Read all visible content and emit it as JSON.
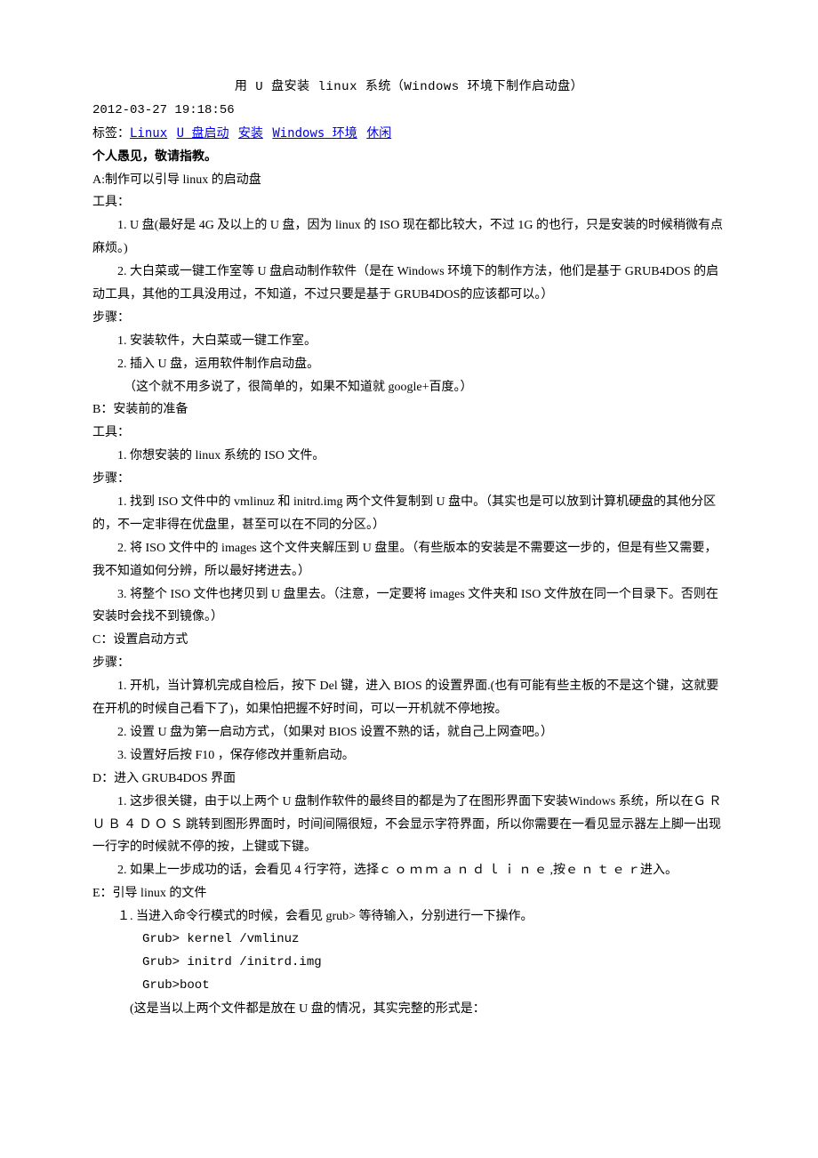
{
  "title": "用 U 盘安装 linux 系统（Windows 环境下制作启动盘）",
  "datetime": "2012-03-27 19:18:56",
  "tagsLabel": "标签：",
  "tags": [
    "Linux",
    "U 盘启动",
    "安装",
    "Windows 环境",
    "休闲"
  ],
  "noticeLine": "个人愚见，敬请指教。",
  "sectionA": {
    "heading": "A:制作可以引导 linux 的启动盘",
    "toolsLabel": "工具：",
    "tool1": "1. U 盘(最好是 4G 及以上的 U 盘，因为 linux 的 ISO 现在都比较大，不过 1G 的也行，只是安装的时候稍微有点麻烦。)",
    "tool2": "2. 大白菜或一键工作室等 U 盘启动制作软件（是在 Windows 环境下的制作方法，他们是基于 GRUB4DOS 的启动工具，其他的工具没用过，不知道，不过只要是基于 GRUB4DOS的应该都可以。）",
    "stepsLabel": "步骤：",
    "step1": "1. 安装软件，大白菜或一键工作室。",
    "step2": "2. 插入 U 盘，运用软件制作启动盘。",
    "step2Note": "（这个就不用多说了，很简单的，如果不知道就 google+百度。）"
  },
  "sectionB": {
    "heading": "B：安装前的准备",
    "toolsLabel": "工具：",
    "tool1": "1. 你想安装的 linux 系统的 ISO 文件。",
    "stepsLabel": "步骤：",
    "step1": "1. 找到 ISO 文件中的 vmlinuz 和 initrd.img 两个文件复制到 U 盘中。（其实也是可以放到计算机硬盘的其他分区的，不一定非得在优盘里，甚至可以在不同的分区。）",
    "step2": "2. 将 ISO 文件中的 images 这个文件夹解压到 U 盘里。（有些版本的安装是不需要这一步的，但是有些又需要，我不知道如何分辨，所以最好拷进去。）",
    "step3": "3. 将整个 ISO 文件也拷贝到 U 盘里去。（注意，一定要将 images 文件夹和 ISO 文件放在同一个目录下。否则在安装时会找不到镜像。）"
  },
  "sectionC": {
    "heading": "C：设置启动方式",
    "stepsLabel": "步骤：",
    "step1": "1. 开机，当计算机完成自检后，按下 Del 键，进入 BIOS 的设置界面.(也有可能有些主板的不是这个键，这就要在开机的时候自己看下了)，如果怕把握不好时间，可以一开机就不停地按。",
    "step2": "2. 设置 U 盘为第一启动方式，（如果对 BIOS 设置不熟的话，就自己上网查吧。）",
    "step3": "3. 设置好后按 F10 ，保存修改并重新启动。"
  },
  "sectionD": {
    "heading": "D：进入 GRUB4DOS 界面",
    "step1": "1. 这步很关键，由于以上两个 U 盘制作软件的最终目的都是为了在图形界面下安装Windows 系统，所以在Ｇ Ｒ Ｕ Ｂ ４ Ｄ Ｏ Ｓ 跳转到图形界面时，时间间隔很短，不会显示字符界面，所以你需要在一看见显示器左上脚一出现一行字的时候就不停的按，上键或下键。",
    "step2": "2. 如果上一步成功的话，会看见 4 行字符，选择ｃ ｏ ｍ ｍ ａ ｎ ｄ  ｌ ｉ ｎ ｅ ,按ｅ ｎ ｔ ｅ ｒ进入。"
  },
  "sectionE": {
    "heading": "E：引导 linux 的文件",
    "step1": "１. 当进入命令行模式的时候，会看见 grub> 等待输入，分别进行一下操作。",
    "code1": "Grub> kernel /vmlinuz",
    "code2": "Grub> initrd /initrd.img",
    "code3": "Grub>boot",
    "note": "(这是当以上两个文件都是放在 U 盘的情况，其实完整的形式是："
  }
}
